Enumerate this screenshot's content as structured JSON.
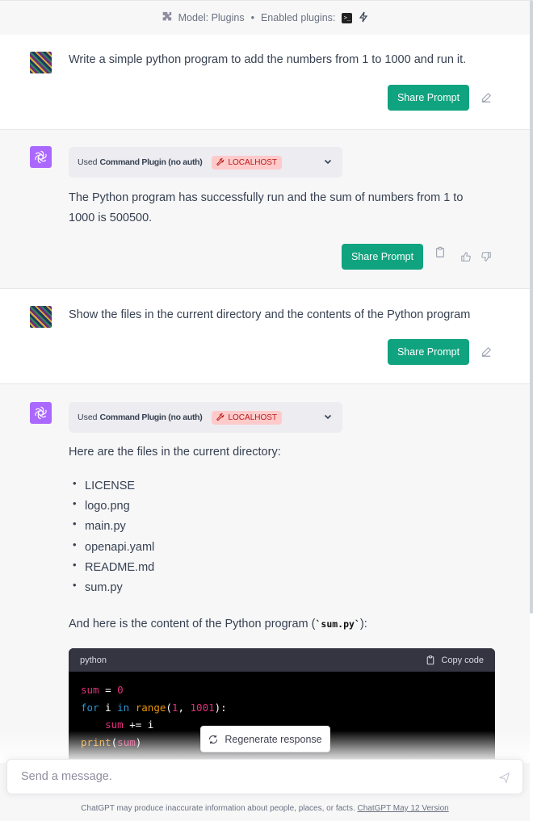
{
  "topbar": {
    "model": "Model: Plugins",
    "separator": "•",
    "enabled": "Enabled plugins:"
  },
  "messages": [
    {
      "role": "user",
      "text": "Write a simple python program to add the numbers from 1 to 1000 and run it."
    },
    {
      "role": "assistant",
      "plugin_used": "Used",
      "plugin_name": "Command Plugin (no auth)",
      "plugin_tag": "LOCALHOST",
      "text": "The Python program has successfully run and the sum of numbers from 1 to 1000 is 500500."
    },
    {
      "role": "user",
      "text": "Show the files in the current directory and the contents of the Python program"
    },
    {
      "role": "assistant",
      "plugin_used": "Used",
      "plugin_name": "Command Plugin (no auth)",
      "plugin_tag": "LOCALHOST",
      "intro": "Here are the files in the current directory:",
      "files": [
        "LICENSE",
        "logo.png",
        "main.py",
        "openapi.yaml",
        "README.md",
        "sum.py"
      ],
      "content_prefix": "And here is the content of the Python program (",
      "content_code": "`sum.py`",
      "content_suffix": "):",
      "code_lang": "python",
      "copy_label": "Copy code"
    }
  ],
  "share_label": "Share Prompt",
  "regenerate_label": "Regenerate response",
  "composer": {
    "placeholder": "Send a message."
  },
  "footer": {
    "text": "ChatGPT may produce inaccurate information about people, places, or facts. ",
    "link": "ChatGPT May 12 Version"
  },
  "colors": {
    "accent": "#10a37f",
    "assistant_avatar": "#ab68ff",
    "localhost_bg": "#fecaca",
    "localhost_text": "#b91c1c"
  }
}
